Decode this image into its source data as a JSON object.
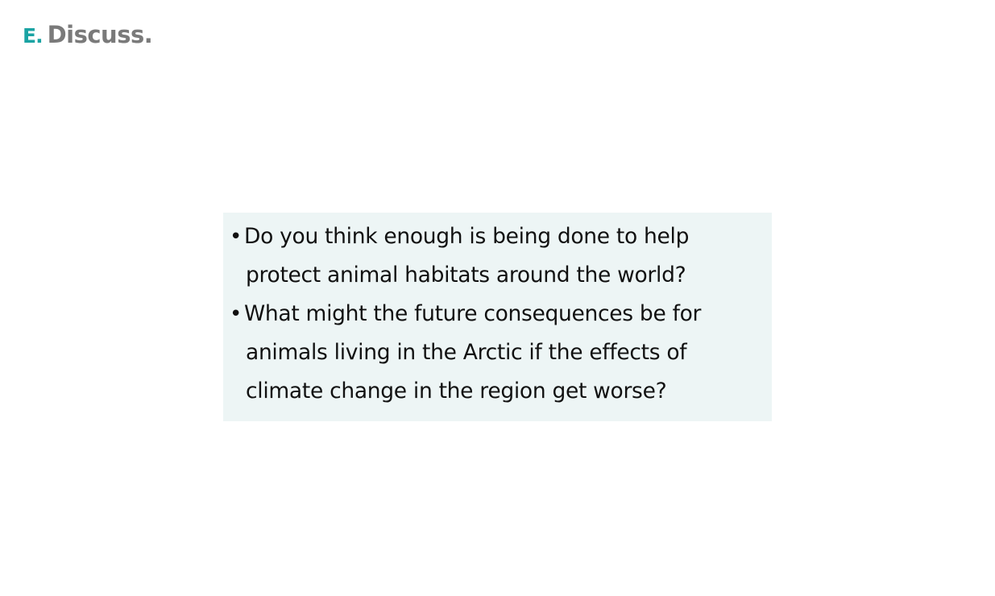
{
  "heading": {
    "letter": "E.",
    "title": "Discuss."
  },
  "questions": [
    {
      "bullet": "•",
      "lines": [
        "Do you think enough is being done to help",
        "protect animal habitats around the world?"
      ]
    },
    {
      "bullet": "•",
      "lines": [
        "What might the future consequences be for",
        "animals living in the Arctic if the effects of",
        "climate change in the region get worse?"
      ]
    }
  ],
  "colors": {
    "accent": "#1aa3a3",
    "heading_text": "#7a7a7a",
    "panel_background": "#edf5f5",
    "body_text": "#111111"
  }
}
